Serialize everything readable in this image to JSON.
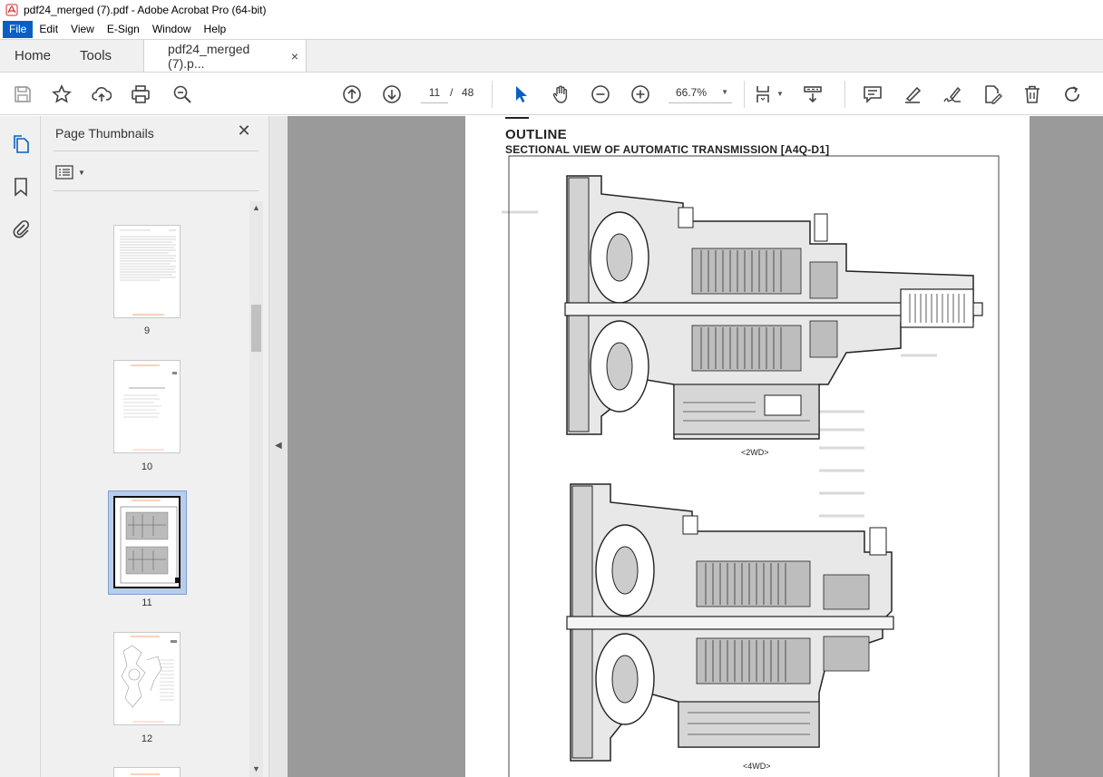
{
  "window": {
    "title": "pdf24_merged (7).pdf - Adobe Acrobat Pro (64-bit)"
  },
  "menu": {
    "items": [
      "File",
      "Edit",
      "View",
      "E-Sign",
      "Window",
      "Help"
    ]
  },
  "tabs": {
    "home": "Home",
    "tools": "Tools",
    "document": "pdf24_merged (7).p...",
    "close_symbol": "×"
  },
  "toolbar": {
    "current_page": "11",
    "separator": "/",
    "total_pages": "48",
    "zoom": "66.7%",
    "icons": [
      "save-icon",
      "star-icon",
      "upload-cloud-icon",
      "print-icon",
      "zoom-search-icon",
      "page-up-icon",
      "page-down-icon",
      "select-cursor-icon",
      "hand-icon",
      "zoom-out-icon",
      "zoom-in-icon",
      "page-display-icon",
      "scroll-mode-icon",
      "comment-icon",
      "highlight-pen-icon",
      "sign-icon",
      "edit-pdf-icon",
      "delete-icon",
      "rotate-icon"
    ]
  },
  "panel": {
    "title": "Page Thumbnails",
    "close_symbol": "✕",
    "thumbnails": [
      {
        "label": "9"
      },
      {
        "label": "10"
      },
      {
        "label": "11"
      },
      {
        "label": "12"
      }
    ],
    "selected": "11"
  },
  "document_page": {
    "heading": "OUTLINE",
    "subheading": "SECTIONAL VIEW OF AUTOMATIC TRANSMISSION [A4Q-D1]",
    "captions": [
      "<2WD>",
      "<4WD>"
    ]
  },
  "colors": {
    "accent": "#0a5fc4",
    "selection": "#b8cde8",
    "viewer_bg": "#9a9a9a"
  }
}
